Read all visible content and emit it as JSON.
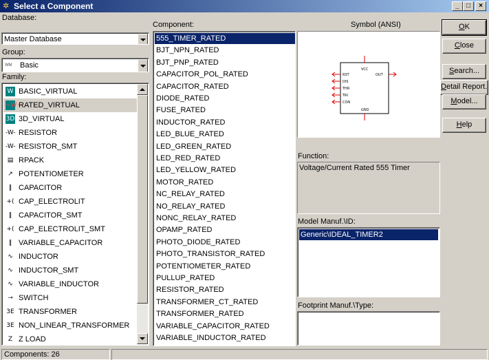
{
  "window": {
    "title": "Select a Component",
    "controls": {
      "minimize": "_",
      "maximize": "□",
      "close": "×"
    }
  },
  "database": {
    "label": "Database:",
    "value": "Master Database"
  },
  "group": {
    "label": "Group:",
    "icon": "basic-group-icon",
    "value": "Basic"
  },
  "family": {
    "label": "Family:",
    "items": [
      {
        "label": "BASIC_VIRTUAL",
        "icon": "basic-virtual-icon",
        "glyph": "W",
        "icon_bg": "#008080",
        "icon_fg": "#ffffff",
        "selected": false
      },
      {
        "label": "RATED_VIRTUAL",
        "icon": "rated-virtual-icon",
        "glyph": "~W~",
        "icon_bg": "#008080",
        "icon_fg": "#ff4040",
        "selected": true
      },
      {
        "label": "3D_VIRTUAL",
        "icon": "3d-virtual-icon",
        "glyph": "3D",
        "icon_bg": "#008080",
        "icon_fg": "#ffffff",
        "selected": false
      },
      {
        "label": "RESISTOR",
        "icon": "resistor-icon",
        "glyph": "-W-",
        "icon_bg": "#ffffff",
        "icon_fg": "#000000",
        "selected": false
      },
      {
        "label": "RESISTOR_SMT",
        "icon": "resistor-smt-icon",
        "glyph": "-W-",
        "icon_bg": "#ffffff",
        "icon_fg": "#000000",
        "selected": false
      },
      {
        "label": "RPACK",
        "icon": "rpack-icon",
        "glyph": "▤",
        "icon_bg": "#ffffff",
        "icon_fg": "#000000",
        "selected": false
      },
      {
        "label": "POTENTIOMETER",
        "icon": "potentiometer-icon",
        "glyph": "↗",
        "icon_bg": "#ffffff",
        "icon_fg": "#000000",
        "selected": false
      },
      {
        "label": "CAPACITOR",
        "icon": "capacitor-icon",
        "glyph": "‖",
        "icon_bg": "#ffffff",
        "icon_fg": "#000000",
        "selected": false
      },
      {
        "label": "CAP_ELECTROLIT",
        "icon": "cap-electrolit-icon",
        "glyph": "+(",
        "icon_bg": "#ffffff",
        "icon_fg": "#000000",
        "selected": false
      },
      {
        "label": "CAPACITOR_SMT",
        "icon": "capacitor-smt-icon",
        "glyph": "‖",
        "icon_bg": "#ffffff",
        "icon_fg": "#000000",
        "selected": false
      },
      {
        "label": "CAP_ELECTROLIT_SMT",
        "icon": "cap-electrolit-smt-icon",
        "glyph": "+(",
        "icon_bg": "#ffffff",
        "icon_fg": "#000000",
        "selected": false
      },
      {
        "label": "VARIABLE_CAPACITOR",
        "icon": "variable-capacitor-icon",
        "glyph": "‖",
        "icon_bg": "#ffffff",
        "icon_fg": "#000000",
        "selected": false
      },
      {
        "label": "INDUCTOR",
        "icon": "inductor-icon",
        "glyph": "∿",
        "icon_bg": "#ffffff",
        "icon_fg": "#000000",
        "selected": false
      },
      {
        "label": "INDUCTOR_SMT",
        "icon": "inductor-smt-icon",
        "glyph": "∿",
        "icon_bg": "#ffffff",
        "icon_fg": "#000000",
        "selected": false
      },
      {
        "label": "VARIABLE_INDUCTOR",
        "icon": "variable-inductor-icon",
        "glyph": "∿",
        "icon_bg": "#ffffff",
        "icon_fg": "#000000",
        "selected": false
      },
      {
        "label": "SWITCH",
        "icon": "switch-icon",
        "glyph": "⊸",
        "icon_bg": "#ffffff",
        "icon_fg": "#000000",
        "selected": false
      },
      {
        "label": "TRANSFORMER",
        "icon": "transformer-icon",
        "glyph": "3E",
        "icon_bg": "#ffffff",
        "icon_fg": "#000000",
        "selected": false
      },
      {
        "label": "NON_LINEAR_TRANSFORMER",
        "icon": "non-linear-transformer-icon",
        "glyph": "3E",
        "icon_bg": "#ffffff",
        "icon_fg": "#000000",
        "selected": false
      },
      {
        "label": "Z LOAD",
        "icon": "z-load-icon",
        "glyph": "Z",
        "icon_bg": "#ffffff",
        "icon_fg": "#000000",
        "selected": false
      }
    ]
  },
  "component": {
    "label": "Component:",
    "items": [
      {
        "label": "555_TIMER_RATED",
        "selected": true
      },
      {
        "label": "BJT_NPN_RATED",
        "selected": false
      },
      {
        "label": "BJT_PNP_RATED",
        "selected": false
      },
      {
        "label": "CAPACITOR_POL_RATED",
        "selected": false
      },
      {
        "label": "CAPACITOR_RATED",
        "selected": false
      },
      {
        "label": "DIODE_RATED",
        "selected": false
      },
      {
        "label": "FUSE_RATED",
        "selected": false
      },
      {
        "label": "INDUCTOR_RATED",
        "selected": false
      },
      {
        "label": "LED_BLUE_RATED",
        "selected": false
      },
      {
        "label": "LED_GREEN_RATED",
        "selected": false
      },
      {
        "label": "LED_RED_RATED",
        "selected": false
      },
      {
        "label": "LED_YELLOW_RATED",
        "selected": false
      },
      {
        "label": "MOTOR_RATED",
        "selected": false
      },
      {
        "label": "NC_RELAY_RATED",
        "selected": false
      },
      {
        "label": "NO_RELAY_RATED",
        "selected": false
      },
      {
        "label": "NONC_RELAY_RATED",
        "selected": false
      },
      {
        "label": "OPAMP_RATED",
        "selected": false
      },
      {
        "label": "PHOTO_DIODE_RATED",
        "selected": false
      },
      {
        "label": "PHOTO_TRANSISTOR_RATED",
        "selected": false
      },
      {
        "label": "POTENTIOMETER_RATED",
        "selected": false
      },
      {
        "label": "PULLUP_RATED",
        "selected": false
      },
      {
        "label": "RESISTOR_RATED",
        "selected": false
      },
      {
        "label": "TRANSFORMER_CT_RATED",
        "selected": false
      },
      {
        "label": "TRANSFORMER_RATED",
        "selected": false
      },
      {
        "label": "VARIABLE_CAPACITOR_RATED",
        "selected": false
      },
      {
        "label": "VARIABLE_INDUCTOR_RATED",
        "selected": false
      }
    ]
  },
  "symbol": {
    "label": "Symbol (ANSI)",
    "pins_top": "VCC",
    "pins_left": [
      "RST",
      "DIS",
      "THR",
      "TRI",
      "CON"
    ],
    "pin_right": "OUT",
    "pin_bottom": "GND",
    "pin_color": "#e00000"
  },
  "function": {
    "label": "Function:",
    "value": "Voltage/Current Rated 555 Timer"
  },
  "model": {
    "label": "Model Manuf.\\ID:",
    "items": [
      {
        "label": "Generic\\IDEAL_TIMER2",
        "selected": true
      }
    ]
  },
  "footprint": {
    "label": "Footprint Manuf.\\Type:"
  },
  "buttons": {
    "ok": {
      "mnemonic": "O",
      "rest": "K"
    },
    "close": {
      "mnemonic": "C",
      "rest": "lose"
    },
    "search": {
      "mnemonic": "S",
      "rest": "earch..."
    },
    "detail_report": {
      "mnemonic": "D",
      "rest": "etail Report..."
    },
    "model": {
      "mnemonic": "M",
      "rest": "odel..."
    },
    "help": {
      "mnemonic": "H",
      "rest": "elp"
    }
  },
  "status": {
    "components_count": "Components: 26"
  },
  "colors": {
    "selection": "#0a246a",
    "face": "#d4d0c8"
  }
}
